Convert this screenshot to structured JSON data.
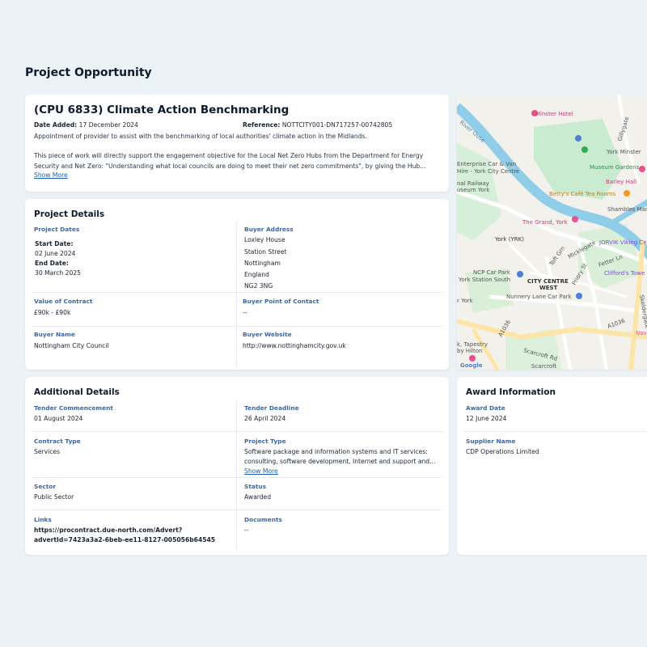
{
  "page_title": "Project Opportunity",
  "project": {
    "title": "(CPU 6833) Climate Action Benchmarking",
    "date_added_label": "Date Added:",
    "date_added": "17 December 2024",
    "reference_label": "Reference:",
    "reference": "NOTTCITY001-DN717257-00742805",
    "description_1": "Appointment of provider to assist with the benchmarking of local authorities' climate action in the Midlands.",
    "description_2": "This piece of work will directly support the engagement objective for the Local Net Zero Hubs from the Department for Energy Security and Net Zero: \"Understanding what local councils are doing to meet their net zero commitments\", by giving the Hub...",
    "show_more": "Show More"
  },
  "details": {
    "title": "Project Details",
    "project_dates_label": "Project Dates",
    "start_date_label": "Start Date:",
    "start_date": "02 June 2024",
    "end_date_label": "End Date:",
    "end_date": "30 March 2025",
    "buyer_address_label": "Buyer Address",
    "buyer_address": [
      "Loxley House",
      "Station Street",
      "Nottingham",
      "England",
      "NG2 3NG"
    ],
    "value_label": "Value of Contract",
    "value": "£90k - £90k",
    "buyer_contact_label": "Buyer Point of Contact",
    "buyer_contact": "--",
    "buyer_name_label": "Buyer Name",
    "buyer_name": "Nottingham City Council",
    "buyer_website_label": "Buyer Website",
    "buyer_website": "http://www.nottinghamcity.gov.uk"
  },
  "map": {
    "labels": {
      "minster_hotel": "Minster Hotel",
      "gillygate": "Gillygate",
      "enterprise_1": "Enterprise Car & Van",
      "enterprise_2": "Hire - York City Centre",
      "york_minster": "York Minster",
      "railway_1": "nal Railway",
      "railway_2": "useum York",
      "museum_gardens": "Museum Gardens",
      "barley_hall": "Barley Hall",
      "bettys": "Betty's Café Tea Rooms",
      "shambles": "Shambles Mar",
      "grand_york": "The Grand, York",
      "york_station": "York (YRK)",
      "jorvik": "JORVIK Viking Ce",
      "toft_grn": "Toft Grn",
      "micklegate": "Micklegate",
      "fetter_ln": "Fetter Ln",
      "cliffords": "Clifford's Towe",
      "ncp_1": "NCP Car Park",
      "ncp_2": "York Station South",
      "city_centre_1": "CITY CENTRE",
      "city_centre_2": "WEST",
      "priory_st": "Priory St",
      "skeldergate": "Skeldergate",
      "nunnery_lane": "Nunnery Lane Car Park",
      "york_fragment": "r York",
      "novot": "Novot",
      "a1036_1": "A1036",
      "a1036_2": "A1036",
      "tapestry_1": "k, Tapestry",
      "tapestry_2": "by Hilton",
      "scarcroft_rd": "Scarcroft Rd",
      "scarcroft": "Scarcroft",
      "google": "Google",
      "river": "River Ouse"
    },
    "colors": {
      "land": "#f3f1ec",
      "park": "#c9ebcf",
      "water": "#8fcde8",
      "road": "#ffffff",
      "main_road": "#fce5a6",
      "pin_pink": "#e8528f",
      "pin_green": "#34a853",
      "pin_orange": "#f29c1f",
      "pin_blue": "#4d7fd9"
    }
  },
  "additional": {
    "title": "Additional Details",
    "tender_commencement_label": "Tender Commencement",
    "tender_commencement": "01 August 2024",
    "tender_deadline_label": "Tender Deadline",
    "tender_deadline": "26 April 2024",
    "contract_type_label": "Contract Type",
    "contract_type": "Services",
    "project_type_label": "Project Type",
    "project_type_1": "Software package and information systems and IT services:",
    "project_type_2": "consulting, software development, Internet and support and...",
    "show_more": "Show More",
    "sector_label": "Sector",
    "sector": "Public Sector",
    "status_label": "Status",
    "status": "Awarded",
    "links_label": "Links",
    "links_1": "https://procontract.due-north.com/Advert?",
    "links_2": "advertId=7423a3a2-6beb-ee11-8127-005056b64545",
    "documents_label": "Documents",
    "documents": "--"
  },
  "award": {
    "title": "Award Information",
    "award_date_label": "Award Date",
    "award_date": "12 June 2024",
    "supplier_label": "Supplier Name",
    "supplier": "CDP Operations Limited"
  }
}
